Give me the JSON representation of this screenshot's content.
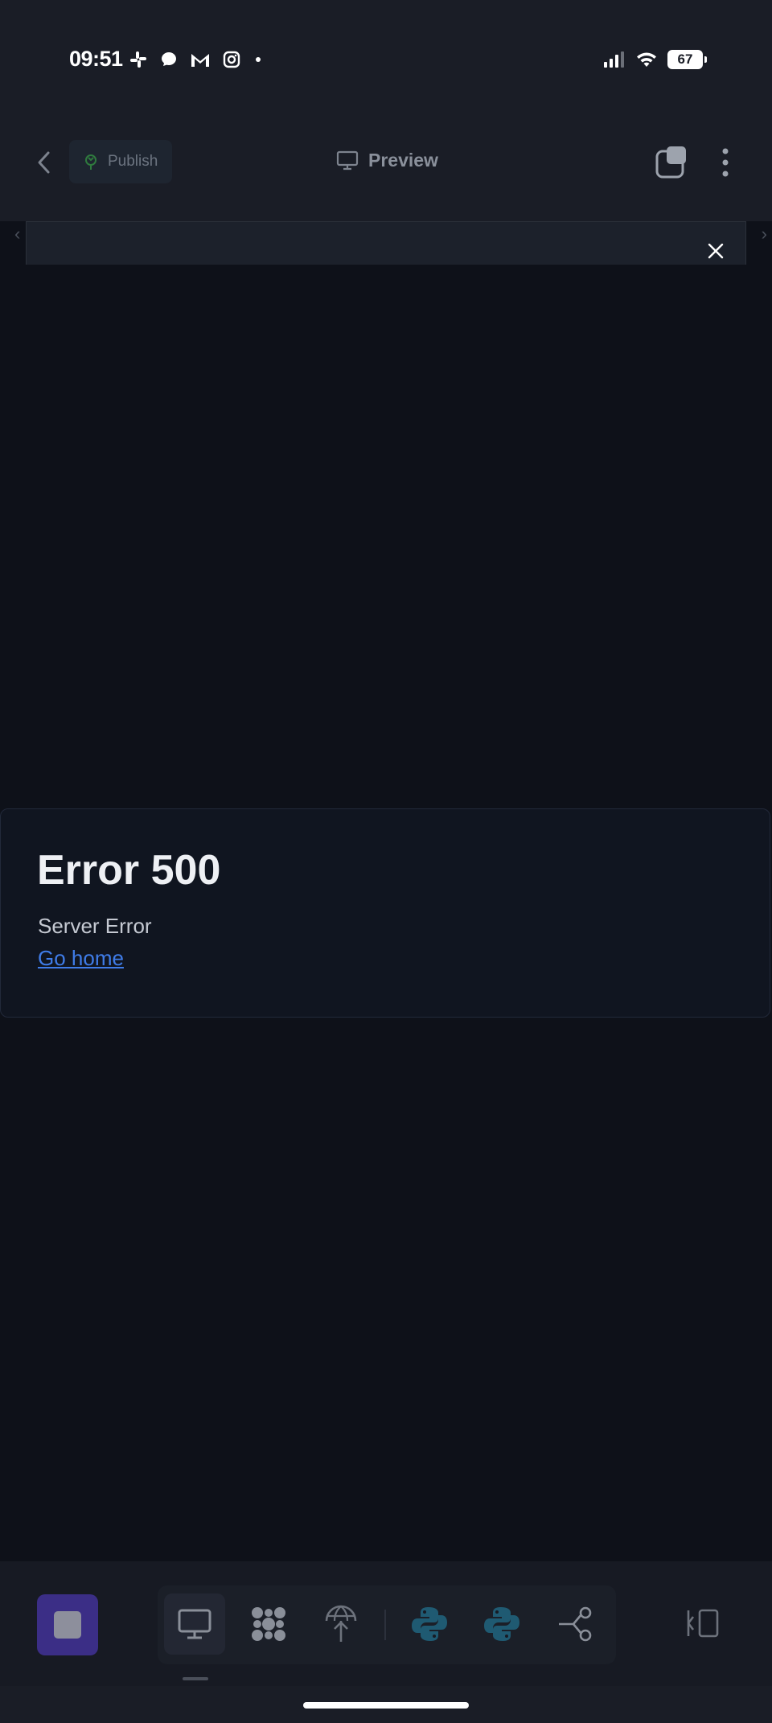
{
  "status_bar": {
    "time": "09:51",
    "notification_icons": [
      "slack-icon",
      "messenger-icon",
      "gmail-icon",
      "instagram-icon",
      "dot-icon"
    ],
    "battery_level": "67"
  },
  "app_bar": {
    "publish_label": "Publish",
    "preview_label": "Preview"
  },
  "error": {
    "title": "Error 500",
    "subtitle": "Server Error",
    "link": "Go home"
  },
  "colors": {
    "background": "#0e1119",
    "bar": "#1a1d26",
    "accent_stop": "#3b2e86",
    "link": "#3f7ce8",
    "python": "#1f5a72"
  },
  "toolbar": {
    "tools": [
      "monitor-icon",
      "puzzle-icon",
      "globe-antenna-icon",
      "python-icon",
      "python-icon",
      "connector-icon"
    ],
    "active_tool": "monitor-icon"
  }
}
